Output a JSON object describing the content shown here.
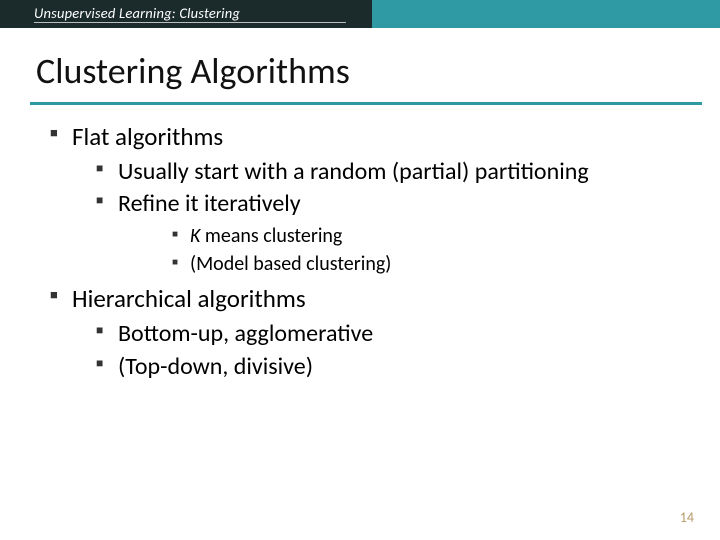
{
  "header": {
    "breadcrumb": "Unsupervised Learning: Clustering"
  },
  "title": "Clustering Algorithms",
  "bullets": {
    "b1": "Flat algorithms",
    "b1_1": "Usually start with a random (partial) partitioning",
    "b1_2": "Refine it iteratively",
    "b1_2_a_prefix": "K",
    "b1_2_a_rest": " means clustering",
    "b1_2_b": "(Model based clustering)",
    "b2": "Hierarchical algorithms",
    "b2_1": "Bottom-up, agglomerative",
    "b2_2": "(Top-down, divisive)"
  },
  "page_number": "14"
}
